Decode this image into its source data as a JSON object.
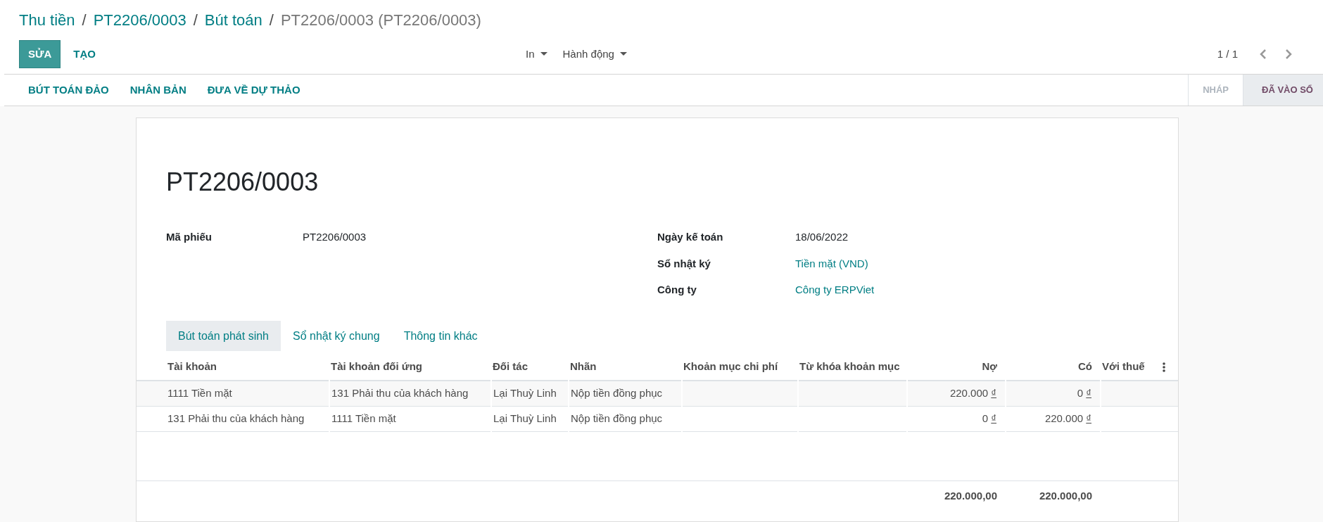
{
  "breadcrumb": [
    {
      "label": "Thu tiền",
      "link": true
    },
    {
      "label": "PT2206/0003",
      "link": true
    },
    {
      "label": "Bút toán",
      "link": true
    },
    {
      "label": "PT2206/0003 (PT2206/0003)",
      "link": false
    }
  ],
  "buttons": [
    {
      "label": "SỬA",
      "kind": "primary"
    },
    {
      "label": "TẠO",
      "kind": "secondary"
    }
  ],
  "menus": [
    "In",
    "Hành động"
  ],
  "pager": "1 / 1",
  "actions": [
    "BÚT TOÁN ĐẢO",
    "NHÂN BẢN",
    "ĐƯA VỀ DỰ THẢO"
  ],
  "statusbar": [
    {
      "label": "NHÁP",
      "selected": false
    },
    {
      "label": "ĐÃ VÀO SỔ",
      "selected": true
    }
  ],
  "title": "PT2206/0003",
  "fields_left": [
    {
      "label": "Mã phiếu",
      "value": "PT2206/0003",
      "link": false
    }
  ],
  "fields_right": [
    {
      "label": "Ngày kế toán",
      "value": "18/06/2022",
      "link": false
    },
    {
      "label": "Sổ nhật ký",
      "value": "Tiền mặt (VND)",
      "link": true
    },
    {
      "label": "Công ty",
      "value": "Công ty ERPViet",
      "link": true
    }
  ],
  "tabs": [
    {
      "label": "Bút toán phát sinh",
      "selected": true
    },
    {
      "label": "Sổ nhật ký chung",
      "selected": false
    },
    {
      "label": "Thông tin khác",
      "selected": false
    }
  ],
  "breadcrumb_separator": "/",
  "table": {
    "columns": [
      {
        "label": "Tài khoản",
        "kind": "text"
      },
      {
        "label": "Tài khoản đối ứng",
        "kind": "text"
      },
      {
        "label": "Đối tác",
        "kind": "text"
      },
      {
        "label": "Nhãn",
        "kind": "text"
      },
      {
        "label": "Khoản mục chi phí",
        "kind": "text"
      },
      {
        "label": "Từ khóa khoản mục",
        "kind": "text"
      },
      {
        "label": "Nợ",
        "kind": "amount"
      },
      {
        "label": "Có",
        "kind": "amount"
      },
      {
        "label": "Với thuế",
        "kind": "text"
      }
    ],
    "rows": [
      {
        "cells": [
          "1111 Tiền mặt",
          "131 Phải thu của khách hàng",
          "Lại Thuỳ Linh",
          "Nộp tiền đồng phục",
          "",
          "",
          "220.000",
          "0",
          ""
        ]
      },
      {
        "cells": [
          "131 Phải thu của khách hàng",
          "1111 Tiền mặt",
          "Lại Thuỳ Linh",
          "Nộp tiền đồng phục",
          "",
          "",
          "0",
          "220.000",
          ""
        ]
      }
    ],
    "currency": "₫",
    "totals": [
      "220.000,00",
      "220.000,00"
    ]
  }
}
